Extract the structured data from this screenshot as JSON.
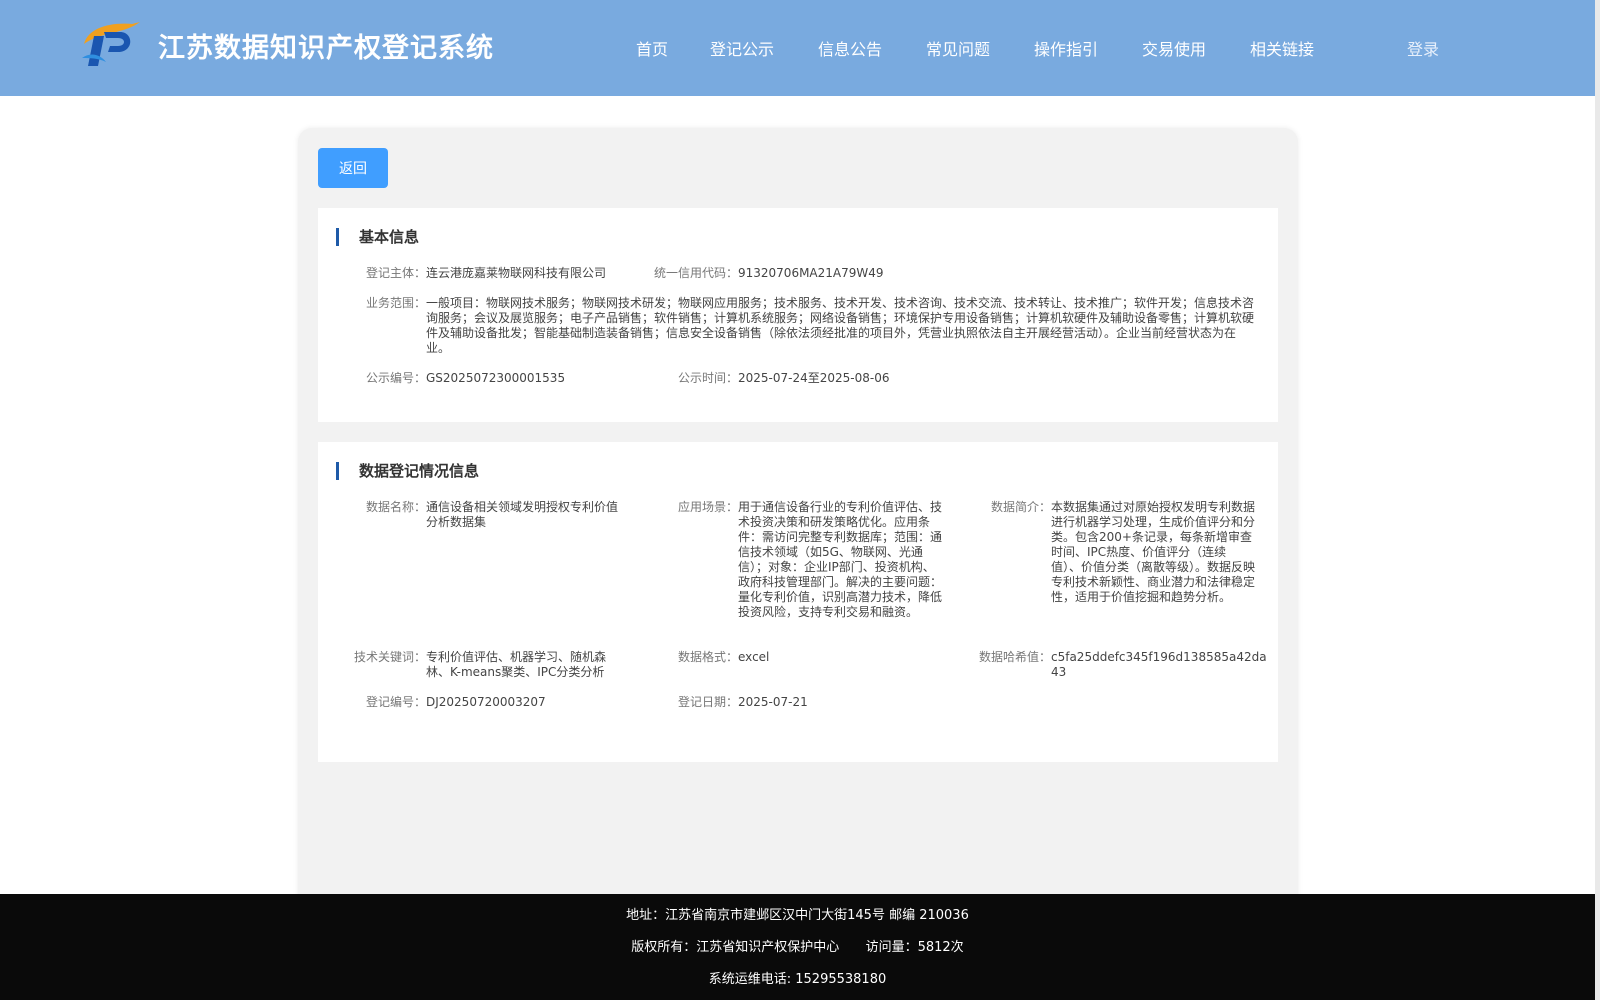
{
  "header": {
    "title": "江苏数据知识产权登记系统",
    "nav": [
      "首页",
      "登记公示",
      "信息公告",
      "常见问题",
      "操作指引",
      "交易使用",
      "相关链接"
    ],
    "login": "登录"
  },
  "back_label": "返回",
  "basic_info": {
    "title": "基本信息",
    "entity_label": "登记主体：",
    "entity": "连云港庞嘉莱物联网科技有限公司",
    "credit_code_label": "统一信用代码：",
    "credit_code": "91320706MA21A79W49",
    "scope_label": "业务范围：",
    "scope": "一般项目：物联网技术服务；物联网技术研发；物联网应用服务；技术服务、技术开发、技术咨询、技术交流、技术转让、技术推广；软件开发；信息技术咨询服务；会议及展览服务；电子产品销售；软件销售；计算机系统服务；网络设备销售；环境保护专用设备销售；计算机软硬件及辅助设备零售；计算机软硬件及辅助设备批发；智能基础制造装备销售；信息安全设备销售（除依法须经批准的项目外，凭营业执照依法自主开展经营活动）。企业当前经营状态为在业。",
    "pub_no_label": "公示编号：",
    "pub_no": "GS2025072300001535",
    "pub_time_label": "公示时间：",
    "pub_time": "2025-07-24至2025-08-06"
  },
  "data_info": {
    "title": "数据登记情况信息",
    "name_label": "数据名称：",
    "name": "通信设备相关领域发明授权专利价值分析数据集",
    "scene_label": "应用场景：",
    "scene": "用于通信设备行业的专利价值评估、技术投资决策和研发策略优化。应用条件：需访问完整专利数据库；范围：通信技术领域（如5G、物联网、光通信）；对象：企业IP部门、投资机构、政府科技管理部门。解决的主要问题：量化专利价值，识别高潜力技术，降低投资风险，支持专利交易和融资。",
    "intro_label": "数据简介：",
    "intro": "本数据集通过对原始授权发明专利数据进行机器学习处理，生成价值评分和分类。包含200+条记录，每条新增审查时间、IPC热度、价值评分（连续值）、价值分类（离散等级）。数据反映专利技术新颖性、商业潜力和法律稳定性，适用于价值挖掘和趋势分析。",
    "keywords_label": "技术关键词：",
    "keywords": "专利价值评估、机器学习、随机森林、K-means聚类、IPC分类分析",
    "format_label": "数据格式：",
    "format": "excel",
    "hash_label": "数据哈希值：",
    "hash": "c5fa25ddefc345f196d138585a42da43",
    "reg_no_label": "登记编号：",
    "reg_no": "DJ20250720003207",
    "reg_date_label": "登记日期：",
    "reg_date": "2025-07-21"
  },
  "footer": {
    "address": "地址：江苏省南京市建邺区汉中门大街145号 邮编 210036",
    "copyright": "版权所有：江苏省知识产权保护中心",
    "visits": "访问量：5812次",
    "phone": "系统运维电话: 15295538180"
  },
  "colors": {
    "header_bg": "#79aadf",
    "button": "#409eff",
    "title_accent": "#1e5aa8",
    "footer_bg": "#0a0a0a"
  }
}
